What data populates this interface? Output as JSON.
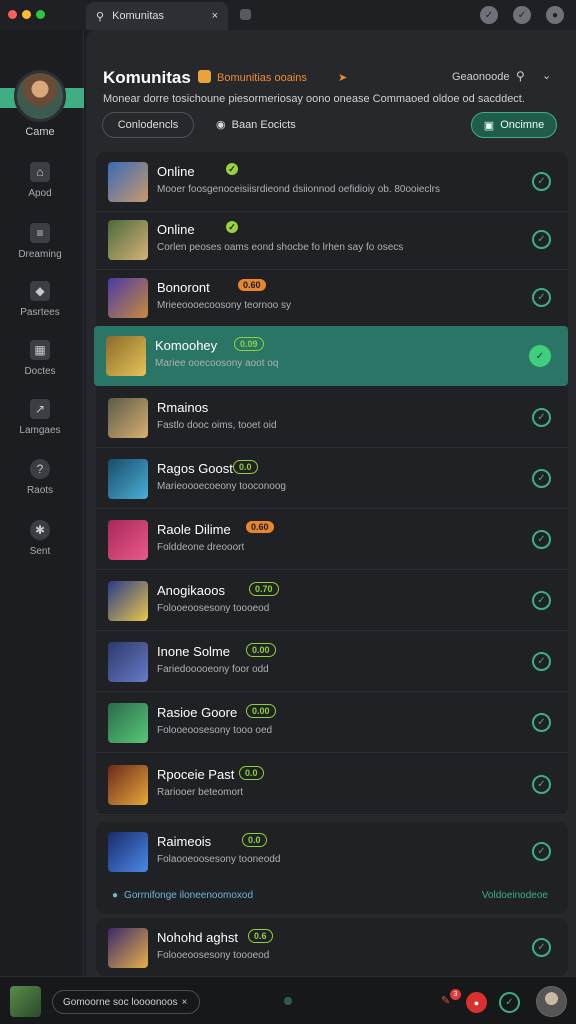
{
  "window": {
    "tab_label": "Komunitas",
    "colors": {
      "close": "#ff5f57",
      "minimize": "#febc2e",
      "maximize": "#28c840"
    }
  },
  "sidebar": {
    "profile_label": "Came",
    "items": [
      {
        "label": "Apod",
        "icon": "home-icon"
      },
      {
        "label": "Dreaming",
        "icon": "chat-icon"
      },
      {
        "label": "Pasrtees",
        "icon": "tag-icon"
      },
      {
        "label": "Doctes",
        "icon": "grid-icon"
      },
      {
        "label": "Lamgaes",
        "icon": "chart-icon"
      },
      {
        "label": "Raots",
        "icon": "help-icon"
      },
      {
        "label": "Sent",
        "icon": "settings-icon"
      }
    ]
  },
  "header": {
    "title": "Komunitas",
    "subtitle": "Bomunitias ooains",
    "right_label": "Geaonoode",
    "description": "Monear dorre tosichoune piesormeriosay oono onease Commaoed oldoe od sacddect.",
    "filter_button": "Conlodencls",
    "location_label": "Baan Eocicts",
    "online_button": "Oncimne"
  },
  "list": [
    {
      "name": "Online",
      "tag": "✓",
      "tag_style": "dot",
      "desc": "Mooer foosgenoceisiisrdieond dsiionnod oefidioiy ob. 80ooieclrs",
      "active": false,
      "thumb": [
        "#3a6ab8",
        "#c79a6a"
      ]
    },
    {
      "name": "Online",
      "tag": "✓",
      "tag_style": "dot",
      "desc": "Corlen peoses oams eond shocbe fo lrhen say fo osecs",
      "active": false,
      "thumb": [
        "#4a6a3a",
        "#d8b27a"
      ]
    },
    {
      "name": "Bonoront",
      "tag": "0.60",
      "tag_style": "orange",
      "desc": "Mrieeoooecoosony teornoo sy",
      "active": false,
      "thumb": [
        "#4a3aa8",
        "#c98a3a"
      ]
    },
    {
      "name": "Komoohey",
      "tag": "0.09",
      "tag_style": "green",
      "desc": "Mariee ooecoosony aoot oq",
      "active": true,
      "thumb": [
        "#8a6a2a",
        "#e8c45a"
      ]
    },
    {
      "name": "Rmainos",
      "tag": "",
      "tag_style": "none",
      "desc": "Fastlo dooc oims, tooet oid",
      "active": false,
      "thumb": [
        "#5a5a4a",
        "#d8b070"
      ]
    },
    {
      "name": "Ragos Goost",
      "tag": "0.0",
      "tag_style": "green",
      "desc": "Marieoooecoeony tooconoog",
      "active": false,
      "thumb": [
        "#1a4a6a",
        "#4ab0d8"
      ]
    },
    {
      "name": "Raole Dilime",
      "tag": "0.60",
      "tag_style": "orange",
      "desc": "Folddeone dreooort",
      "active": false,
      "thumb": [
        "#a8285a",
        "#e85a8a"
      ]
    },
    {
      "name": "Anogikaoos",
      "tag": "0.70",
      "tag_style": "green",
      "desc": "Folooeoosesony toooeod",
      "active": false,
      "thumb": [
        "#2a3a8a",
        "#e8c84a"
      ]
    },
    {
      "name": "Inone Solme",
      "tag": "0.00",
      "tag_style": "green",
      "desc": "Fariedooooeony foor odd",
      "active": false,
      "thumb": [
        "#2a3a6a",
        "#6a7ac8"
      ]
    },
    {
      "name": "Rasioe Goore",
      "tag": "0.00",
      "tag_style": "green",
      "desc": "Folooeoosesony tooo oed",
      "active": false,
      "thumb": [
        "#2a6a4a",
        "#5ac87a"
      ]
    },
    {
      "name": "Rpoceie Past",
      "tag": "0.0",
      "tag_style": "green",
      "desc": "Rariooer beteomort",
      "active": false,
      "thumb": [
        "#6a2a1a",
        "#e8a83a"
      ]
    }
  ],
  "list_b": {
    "name": "Raimeois",
    "tag": "0.0",
    "desc": "Folaooeoosesony tooneodd",
    "footer_left": "Gorrnifonge iloneenoomoxod",
    "footer_right": "Voldoeinodeoe",
    "thumb": [
      "#1a2a6a",
      "#4a8ae8"
    ]
  },
  "list_c": {
    "name": "Nohohd aghst",
    "tag": "0.6",
    "desc": "Folooeoosesony toooeod",
    "thumb": [
      "#3a2a6a",
      "#e8b04a"
    ]
  },
  "bottombar": {
    "input_text": "Gomoorne soc loooonoos",
    "notification_count": "3"
  }
}
